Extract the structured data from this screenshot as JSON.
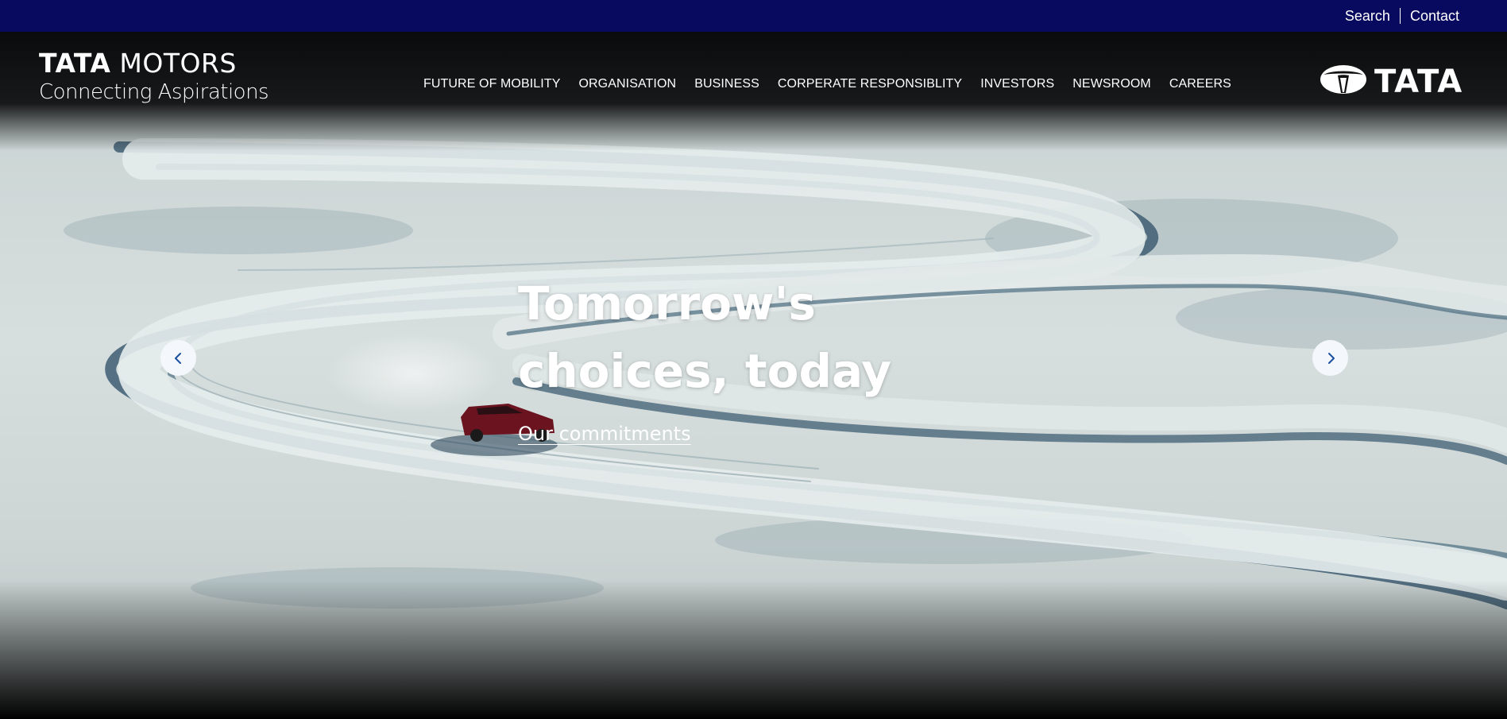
{
  "utility_nav": {
    "search_label": "Search",
    "contact_label": "Contact"
  },
  "brand": {
    "name_bold": "TATA",
    "name_light": "MOTORS",
    "tagline": "Connecting Aspirations"
  },
  "main_nav": {
    "items": [
      {
        "label": "FUTURE OF MOBILITY"
      },
      {
        "label": "ORGANISATION"
      },
      {
        "label": "BUSINESS"
      },
      {
        "label": "CORPERATE RESPONSIBLITY"
      },
      {
        "label": "INVESTORS"
      },
      {
        "label": "NEWSROOM"
      },
      {
        "label": "CAREERS"
      }
    ]
  },
  "group_logo": {
    "wordmark": "TATA",
    "icon": "tata-emblem-icon"
  },
  "hero": {
    "title": "Tomorrow's choices, today",
    "cta_label": "Our commitments"
  },
  "carousel": {
    "prev_icon": "chevron-left-icon",
    "next_icon": "chevron-right-icon"
  },
  "colors": {
    "utility_bar": "#070a5e",
    "arrow_color": "#1a4fa0",
    "car": "#6b1420",
    "snow": "#d4dcdb",
    "track_shadow": "#3f5f74"
  }
}
